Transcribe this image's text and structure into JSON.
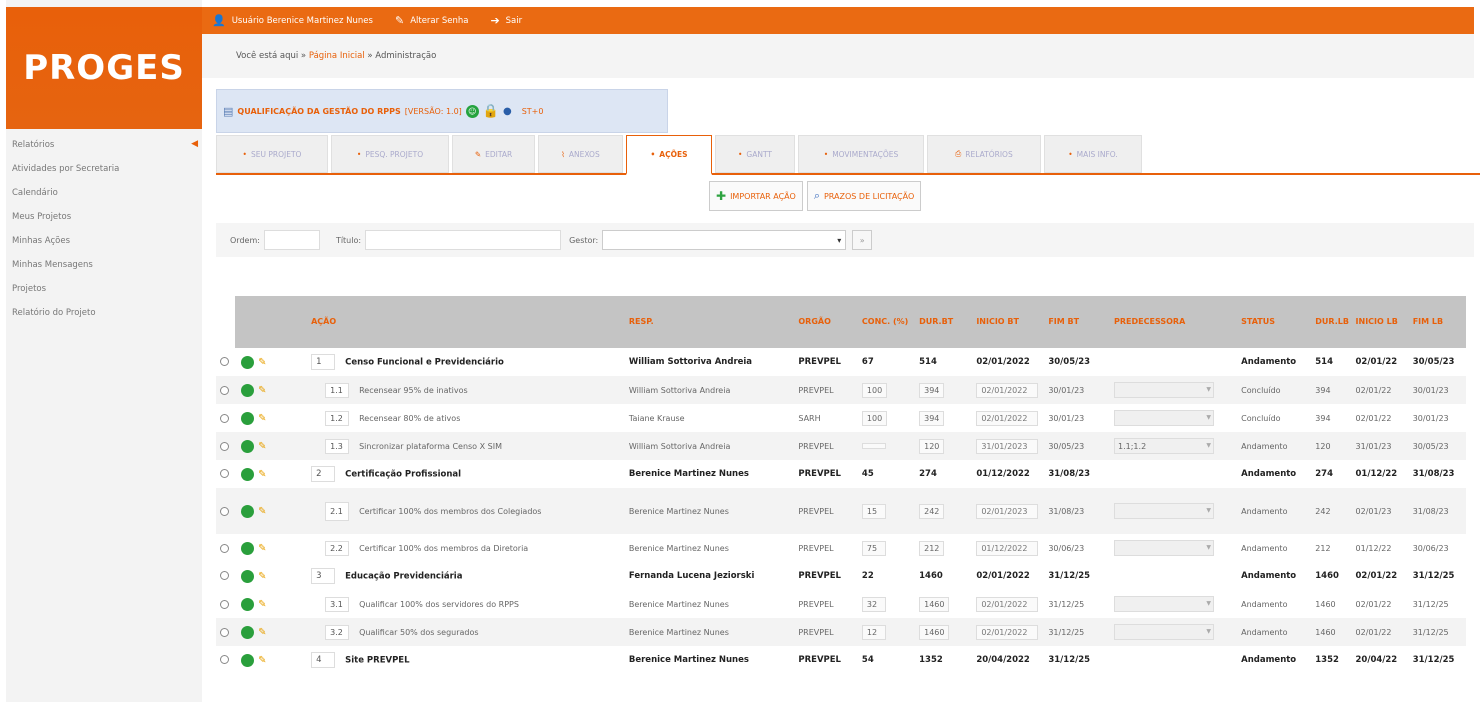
{
  "logo": "PROGES",
  "sidebar": {
    "items": [
      "Relatórios",
      "Atividades por Secretaria",
      "Calendário",
      "Meus Projetos",
      "Minhas Ações",
      "Minhas Mensagens",
      "Projetos",
      "Relatório do Projeto"
    ]
  },
  "topbar": {
    "user": "Usuário Berenice Martinez Nunes",
    "change_password": "Alterar Senha",
    "logout": "Sair"
  },
  "breadcrumb": {
    "prefix": "Você está aqui »",
    "home": "Página Inicial",
    "current": "» Administração"
  },
  "project": {
    "title": "QUALIFICAÇÃO DA GESTÃO DO RPPS",
    "version": "[VERSÃO: 1.0]",
    "id": "ST+0"
  },
  "tabs": [
    "SEU PROJETO",
    "PESQ. PROJETO",
    "EDITAR",
    "ANEXOS",
    "AÇÕES",
    "GANTT",
    "MOVIMENTAÇÕES",
    "RELATÓRIOS",
    "MAIS INFO."
  ],
  "buttons": {
    "import_action": "IMPORTAR AÇÃO",
    "bidding_deadlines": "PRAZOS DE LICITAÇÃO"
  },
  "filters": {
    "order_label": "Ordem:",
    "title_label": "Título:",
    "manager_label": "Gestor:",
    "go_label": "»"
  },
  "table": {
    "headers": {
      "action": "AÇÃO",
      "resp": "RESP.",
      "organ": "ORGÃO",
      "conc": "CONC. (%)",
      "dur_bt": "DUR.BT",
      "start_bt": "INICIO BT",
      "end_bt": "FIM BT",
      "predecessor": "PREDECESSORA",
      "status": "STATUS",
      "dur_lb": "DUR.LB",
      "start_lb": "INICIO LB",
      "end_lb": "FIM LB"
    },
    "rows": [
      {
        "type": "parent",
        "num": "1",
        "title": "Censo Funcional e Previdenciário",
        "resp": "William Sottoriva Andreia",
        "organ": "PREVPEL",
        "conc": "67",
        "dur_bt": "514",
        "start_bt": "02/01/2022",
        "end_bt": "30/05/23",
        "pred": "",
        "status": "Andamento",
        "dur_lb": "514",
        "start_lb": "02/01/22",
        "end_lb": "30/05/23"
      },
      {
        "type": "child",
        "num": "1.1",
        "title": "Recensear 95% de inativos",
        "resp": "William Sottoriva Andreia",
        "organ": "PREVPEL",
        "conc": "100",
        "dur_bt": "394",
        "start_bt": "02/01/2022",
        "end_bt": "30/01/23",
        "pred": "",
        "status": "Concluído",
        "dur_lb": "394",
        "start_lb": "02/01/22",
        "end_lb": "30/01/23"
      },
      {
        "type": "child",
        "num": "1.2",
        "title": "Recensear 80% de ativos",
        "resp": "Taiane Krause",
        "organ": "SARH",
        "conc": "100",
        "dur_bt": "394",
        "start_bt": "02/01/2022",
        "end_bt": "30/01/23",
        "pred": "",
        "status": "Concluído",
        "dur_lb": "394",
        "start_lb": "02/01/22",
        "end_lb": "30/01/23"
      },
      {
        "type": "child",
        "num": "1.3",
        "title": "Sincronizar plataforma Censo X SIM",
        "resp": "William Sottoriva Andreia",
        "organ": "PREVPEL",
        "conc": "",
        "dur_bt": "120",
        "start_bt": "31/01/2023",
        "end_bt": "30/05/23",
        "pred": "1.1;1.2",
        "status": "Andamento",
        "dur_lb": "120",
        "start_lb": "31/01/23",
        "end_lb": "30/05/23"
      },
      {
        "type": "parent",
        "num": "2",
        "title": "Certificação Profissional",
        "resp": "Berenice Martinez Nunes",
        "organ": "PREVPEL",
        "conc": "45",
        "dur_bt": "274",
        "start_bt": "01/12/2022",
        "end_bt": "31/08/23",
        "pred": "",
        "status": "Andamento",
        "dur_lb": "274",
        "start_lb": "01/12/22",
        "end_lb": "31/08/23"
      },
      {
        "type": "child",
        "tall": true,
        "num": "2.1",
        "title": "Certificar 100% dos membros dos Colegiados",
        "resp": "Berenice Martinez Nunes",
        "organ": "PREVPEL",
        "conc": "15",
        "dur_bt": "242",
        "start_bt": "02/01/2023",
        "end_bt": "31/08/23",
        "pred": "",
        "status": "Andamento",
        "dur_lb": "242",
        "start_lb": "02/01/23",
        "end_lb": "31/08/23"
      },
      {
        "type": "child",
        "num": "2.2",
        "title": "Certificar 100% dos membros da Diretoria",
        "resp": "Berenice Martinez Nunes",
        "organ": "PREVPEL",
        "conc": "75",
        "dur_bt": "212",
        "start_bt": "01/12/2022",
        "end_bt": "30/06/23",
        "pred": "",
        "status": "Andamento",
        "dur_lb": "212",
        "start_lb": "01/12/22",
        "end_lb": "30/06/23"
      },
      {
        "type": "parent",
        "num": "3",
        "title": "Educação Previdenciária",
        "resp": "Fernanda Lucena Jeziorski",
        "organ": "PREVPEL",
        "conc": "22",
        "dur_bt": "1460",
        "start_bt": "02/01/2022",
        "end_bt": "31/12/25",
        "pred": "",
        "status": "Andamento",
        "dur_lb": "1460",
        "start_lb": "02/01/22",
        "end_lb": "31/12/25"
      },
      {
        "type": "child",
        "num": "3.1",
        "title": "Qualificar 100% dos servidores do RPPS",
        "resp": "Berenice Martinez Nunes",
        "organ": "PREVPEL",
        "conc": "32",
        "dur_bt": "1460",
        "start_bt": "02/01/2022",
        "end_bt": "31/12/25",
        "pred": "",
        "status": "Andamento",
        "dur_lb": "1460",
        "start_lb": "02/01/22",
        "end_lb": "31/12/25"
      },
      {
        "type": "child",
        "num": "3.2",
        "title": "Qualificar 50% dos segurados",
        "resp": "Berenice Martinez Nunes",
        "organ": "PREVPEL",
        "conc": "12",
        "dur_bt": "1460",
        "start_bt": "02/01/2022",
        "end_bt": "31/12/25",
        "pred": "",
        "status": "Andamento",
        "dur_lb": "1460",
        "start_lb": "02/01/22",
        "end_lb": "31/12/25"
      },
      {
        "type": "parent",
        "num": "4",
        "title": "Site PREVPEL",
        "resp": "Berenice Martinez Nunes",
        "organ": "PREVPEL",
        "conc": "54",
        "dur_bt": "1352",
        "start_bt": "20/04/2022",
        "end_bt": "31/12/25",
        "pred": "",
        "status": "Andamento",
        "dur_lb": "1352",
        "start_lb": "20/04/22",
        "end_lb": "31/12/25"
      }
    ]
  }
}
